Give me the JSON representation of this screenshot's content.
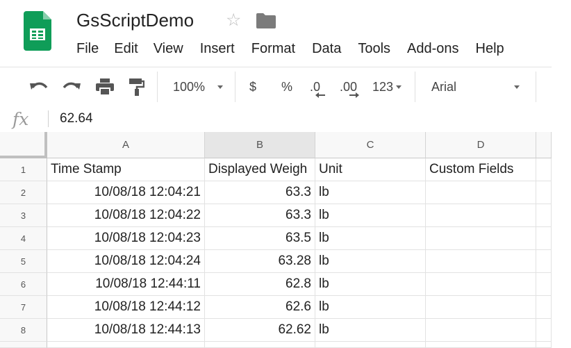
{
  "app": {
    "title": "GsScriptDemo"
  },
  "menu": [
    "File",
    "Edit",
    "View",
    "Insert",
    "Format",
    "Data",
    "Tools",
    "Add-ons",
    "Help"
  ],
  "toolbar": {
    "zoom": "100%",
    "currency": "$",
    "percent": "%",
    "decrease_decimal": ".0",
    "increase_decimal": ".00",
    "more_formats": "123",
    "font": "Arial"
  },
  "formula_bar": {
    "value": "62.64"
  },
  "grid": {
    "columns": [
      "A",
      "B",
      "C",
      "D"
    ],
    "selected_column": "B",
    "rows": [
      {
        "num": "1",
        "cells": [
          "Time Stamp",
          "Displayed Weigh",
          "Unit",
          "Custom Fields"
        ]
      },
      {
        "num": "2",
        "cells": [
          "10/08/18 12:04:21",
          "63.3",
          "lb",
          ""
        ]
      },
      {
        "num": "3",
        "cells": [
          "10/08/18 12:04:22",
          "63.3",
          "lb",
          ""
        ]
      },
      {
        "num": "4",
        "cells": [
          "10/08/18 12:04:23",
          "63.5",
          "lb",
          ""
        ]
      },
      {
        "num": "5",
        "cells": [
          "10/08/18 12:04:24",
          "63.28",
          "lb",
          ""
        ]
      },
      {
        "num": "6",
        "cells": [
          "10/08/18 12:44:11",
          "62.8",
          "lb",
          ""
        ]
      },
      {
        "num": "7",
        "cells": [
          "10/08/18 12:44:12",
          "62.6",
          "lb",
          ""
        ]
      },
      {
        "num": "8",
        "cells": [
          "10/08/18 12:44:13",
          "62.62",
          "lb",
          ""
        ]
      }
    ]
  },
  "colors": {
    "sheets_green": "#0F9D58",
    "header_bg": "#f8f8f8",
    "selected_header_bg": "#e6e6e6"
  }
}
